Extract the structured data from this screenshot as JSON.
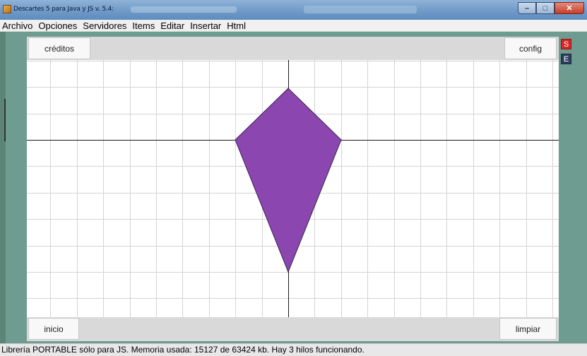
{
  "window": {
    "title": "Descartes 5 para Java y JS v. 5.4:",
    "minimize_icon": "minimize-icon",
    "maximize_icon": "maximize-icon",
    "close_icon": "close-icon"
  },
  "menu": {
    "items": [
      "Archivo",
      "Opciones",
      "Servidores",
      "Items",
      "Editar",
      "Insertar",
      "Html"
    ]
  },
  "scene": {
    "credits_label": "créditos",
    "config_label": "config",
    "start_label": "inicio",
    "clear_label": "limpiar"
  },
  "side_buttons": {
    "s_label": "S",
    "e_label": "E"
  },
  "graph": {
    "grid_color": "#d4d4d4",
    "axis_color": "#1a1a1a",
    "polygon_fill": "#8b46b0",
    "polygon_stroke": "#3a2050"
  },
  "status": {
    "text": "Librería PORTABLE sólo para JS. Memoria usada: 15127 de 63424 kb. Hay 3 hilos funcionando."
  }
}
